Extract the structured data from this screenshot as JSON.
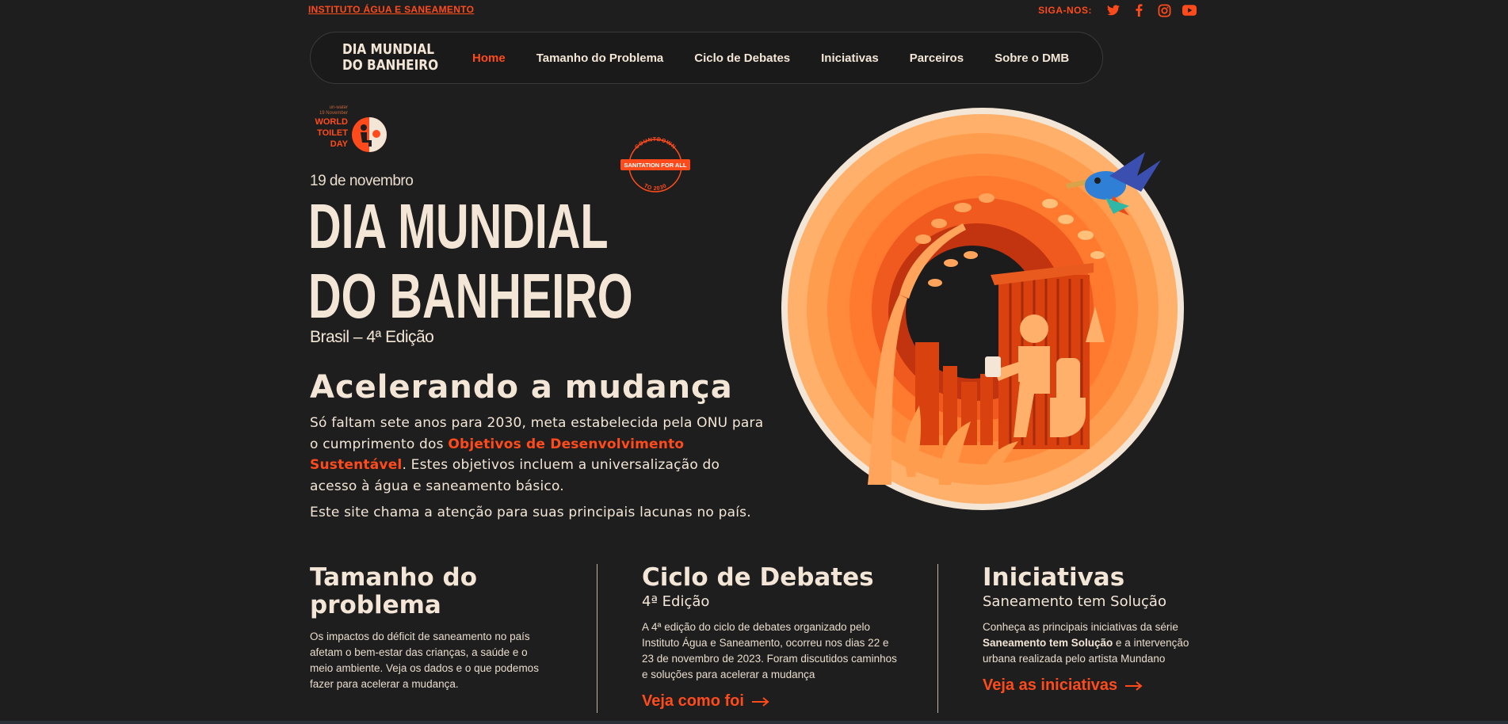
{
  "topbar": {
    "institute_link": "INSTITUTO ÁGUA E SANEAMENTO",
    "social_label": "SIGA-NOS:",
    "social_icons": [
      "twitter-icon",
      "facebook-icon",
      "instagram-icon",
      "youtube-icon"
    ]
  },
  "nav": {
    "logo_line1": "DIA MUNDIAL",
    "logo_line2": "DO BANHEIRO",
    "items": [
      {
        "label": "Home",
        "active": true
      },
      {
        "label": "Tamanho do Problema"
      },
      {
        "label": "Ciclo de Debates"
      },
      {
        "label": "Iniciativas"
      },
      {
        "label": "Parceiros"
      },
      {
        "label": "Sobre o DMB"
      }
    ]
  },
  "hero": {
    "wtd_small_line1": "un-water",
    "wtd_small_line2": "19 November",
    "wtd_line1": "WORLD",
    "wtd_line2": "TOILET",
    "wtd_line3": "DAY",
    "badge_top": "COUNTDOWN",
    "badge_middle": "SANITATION FOR ALL",
    "badge_bottom": "TO 2030",
    "date": "19 de novembro",
    "title_line1": "DIA MUNDIAL",
    "title_line2": "DO BANHEIRO",
    "edition": "Brasil – 4ª Edição",
    "tagline": "Acelerando a mudança",
    "intro_before": "Só faltam sete anos para 2030, meta estabelecida pela ONU para o cumprimento dos ",
    "intro_highlight": "Objetivos de Desenvolvimento Sustentável",
    "intro_after": ". Estes objetivos incluem a universalização do acesso à água e saneamento básico.",
    "intro2": "Este site chama a atenção para suas principais lacunas no país."
  },
  "cards": {
    "problem": {
      "title_line1": "Tamanho do",
      "title_line2": "problema",
      "text": "Os impactos do déficit de saneamento no país afetam o bem-estar das crianças, a saúde e o meio ambiente. Veja os dados e o que podemos fazer para acelerar a mudança."
    },
    "debates": {
      "title": "Ciclo de Debates",
      "subtitle": "4ª Edição",
      "text": "A 4ª edição do ciclo de debates organizado pelo Instituto Água e Saneamento, ocorreu nos dias 22 e 23 de novembro de 2023. Foram discutidos caminhos e soluções para acelerar a mudança",
      "link": "Veja como foi"
    },
    "initiatives": {
      "title": "Iniciativas",
      "subtitle": "Saneamento tem Solução",
      "text_before": "Conheça as principais iniciativas da série ",
      "text_bold": "Saneamento tem Solução",
      "text_after": " e a intervenção urbana realizada pelo artista Mundano",
      "link": "Veja as iniciativas"
    }
  },
  "colors": {
    "background": "#1e1e1e",
    "accent": "#ff4b1c",
    "text": "#f3e6d6"
  }
}
